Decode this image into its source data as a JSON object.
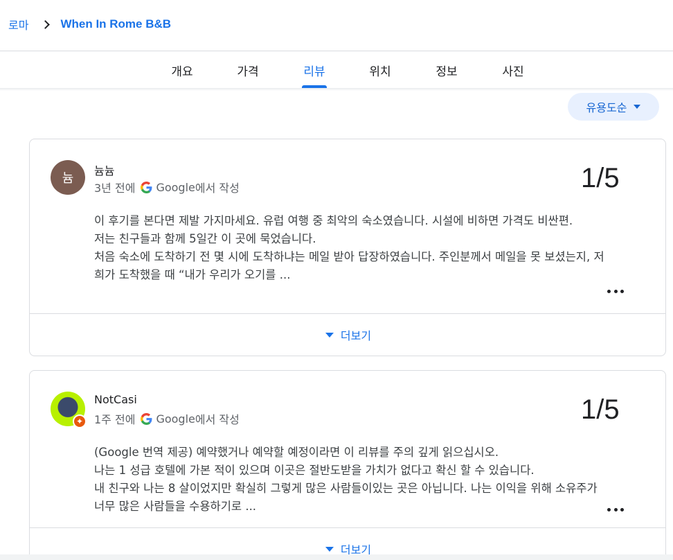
{
  "breadcrumb": {
    "root": "로마",
    "current": "When In Rome B&B"
  },
  "tabs": [
    {
      "label": "개요",
      "active": false
    },
    {
      "label": "가격",
      "active": false
    },
    {
      "label": "리뷰",
      "active": true
    },
    {
      "label": "위치",
      "active": false
    },
    {
      "label": "정보",
      "active": false
    },
    {
      "label": "사진",
      "active": false
    }
  ],
  "sort": {
    "label": "유용도순"
  },
  "reviews": [
    {
      "author": "늄늄",
      "avatar_initial": "늄",
      "time": "3년 전에",
      "source": "Google",
      "source_suffix": "에서 작성",
      "rating": "1/5",
      "lines": [
        "이 후기를 본다면 제발 가지마세요. 유럽 여행 중 최악의 숙소였습니다. 시설에 비하면 가격도 비싼편.",
        "저는 친구들과 함께 5일간 이 곳에 묵었습니다.",
        "처음 숙소에 도착하기 전 몇 시에 도착하냐는 메일 받아 답장하였습니다. 주인분께서 메일을 못 보셨는지, 저희가 도착했을 때 “내가 우리가 오기를 ..."
      ],
      "see_more": "더보기"
    },
    {
      "author": "NotCasi",
      "time": "1주 전에",
      "source": "Google",
      "source_suffix": "에서 작성",
      "rating": "1/5",
      "lines": [
        "(Google 번역 제공) 예약했거나 예약할 예정이라면 이 리뷰를 주의 깊게 읽으십시오.",
        "나는 1 성급 호텔에 가본 적이 있으며 이곳은 절반도받을 가치가 없다고 확신 할 수 있습니다.",
        "내 친구와 나는 8 살이었지만 확실히 그렇게 많은 사람들이있는 곳은 아닙니다. 나는 이익을 위해 소유주가 너무 많은 사람들을 수용하기로 ..."
      ],
      "see_more": "더보기"
    }
  ],
  "colors": {
    "accent": "#1a73e8",
    "sort_bg": "#e8f0fe",
    "avatar1": "#7b5c51",
    "avatar2": "#b8f000",
    "badge": "#e8590c"
  }
}
